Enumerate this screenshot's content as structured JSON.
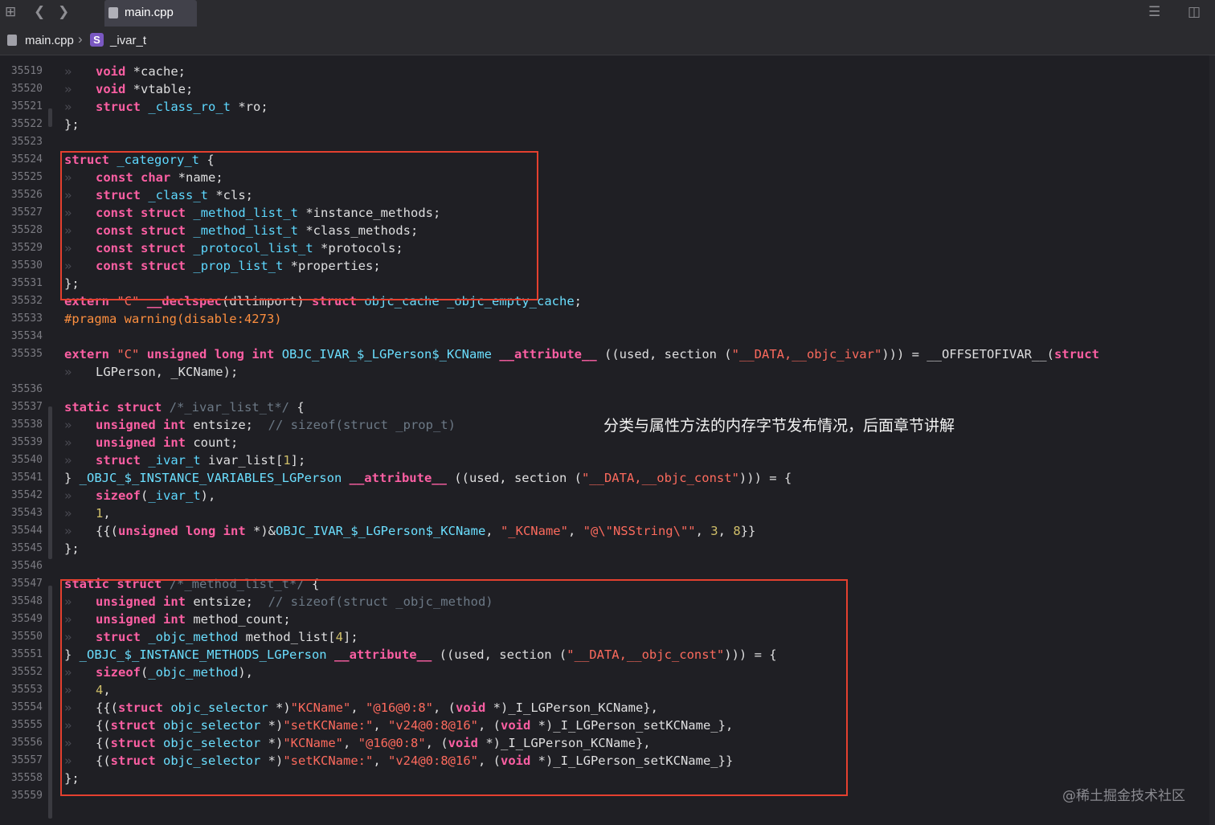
{
  "tab": {
    "label": "main.cpp"
  },
  "jumpbar": {
    "file": "main.cpp",
    "symbol_badge": "S",
    "symbol": "_ivar_t"
  },
  "annotation": "分类与属性方法的内存字节发布情况，后面章节讲解",
  "watermark": "@稀土掘金技术社区",
  "lines": [
    {
      "n": "35519",
      "lvl": 1,
      "code": "void *cache;"
    },
    {
      "n": "35520",
      "lvl": 1,
      "code": "void *vtable;"
    },
    {
      "n": "35521",
      "lvl": 1,
      "code": "struct _class_ro_t *ro;"
    },
    {
      "n": "35522",
      "lvl": 0,
      "code": "};"
    },
    {
      "n": "35523",
      "lvl": 0,
      "code": ""
    },
    {
      "n": "35524",
      "lvl": 0,
      "code": "struct _category_t {"
    },
    {
      "n": "35525",
      "lvl": 1,
      "code": "const char *name;"
    },
    {
      "n": "35526",
      "lvl": 1,
      "code": "struct _class_t *cls;"
    },
    {
      "n": "35527",
      "lvl": 1,
      "code": "const struct _method_list_t *instance_methods;"
    },
    {
      "n": "35528",
      "lvl": 1,
      "code": "const struct _method_list_t *class_methods;"
    },
    {
      "n": "35529",
      "lvl": 1,
      "code": "const struct _protocol_list_t *protocols;"
    },
    {
      "n": "35530",
      "lvl": 1,
      "code": "const struct _prop_list_t *properties;"
    },
    {
      "n": "35531",
      "lvl": 0,
      "code": "};"
    },
    {
      "n": "35532",
      "lvl": 0,
      "code": "extern \"C\" __declspec(dllimport) struct objc_cache _objc_empty_cache;"
    },
    {
      "n": "35533",
      "lvl": 0,
      "code": "#pragma warning(disable:4273)"
    },
    {
      "n": "35534",
      "lvl": 0,
      "code": ""
    },
    {
      "n": "35535",
      "lvl": 0,
      "code": "extern \"C\" unsigned long int OBJC_IVAR_$_LGPerson$_KCName __attribute__ ((used, section (\"__DATA,__objc_ivar\"))) = __OFFSETOFIVAR__(struct"
    },
    {
      "n": "",
      "lvl": 1,
      "code": "LGPerson, _KCName);"
    },
    {
      "n": "35536",
      "lvl": 0,
      "code": ""
    },
    {
      "n": "35537",
      "lvl": 0,
      "code": "static struct /*_ivar_list_t*/ {"
    },
    {
      "n": "35538",
      "lvl": 1,
      "code": "unsigned int entsize;  // sizeof(struct _prop_t)"
    },
    {
      "n": "35539",
      "lvl": 1,
      "code": "unsigned int count;"
    },
    {
      "n": "35540",
      "lvl": 1,
      "code": "struct _ivar_t ivar_list[1];"
    },
    {
      "n": "35541",
      "lvl": 0,
      "code": "} _OBJC_$_INSTANCE_VARIABLES_LGPerson __attribute__ ((used, section (\"__DATA,__objc_const\"))) = {"
    },
    {
      "n": "35542",
      "lvl": 1,
      "code": "sizeof(_ivar_t),"
    },
    {
      "n": "35543",
      "lvl": 1,
      "code": "1,"
    },
    {
      "n": "35544",
      "lvl": 1,
      "code": "{{(unsigned long int *)&OBJC_IVAR_$_LGPerson$_KCName, \"_KCName\", \"@\\\"NSString\\\"\", 3, 8}}"
    },
    {
      "n": "35545",
      "lvl": 0,
      "code": "};"
    },
    {
      "n": "35546",
      "lvl": 0,
      "code": ""
    },
    {
      "n": "35547",
      "lvl": 0,
      "code": "static struct /*_method_list_t*/ {"
    },
    {
      "n": "35548",
      "lvl": 1,
      "code": "unsigned int entsize;  // sizeof(struct _objc_method)"
    },
    {
      "n": "35549",
      "lvl": 1,
      "code": "unsigned int method_count;"
    },
    {
      "n": "35550",
      "lvl": 1,
      "code": "struct _objc_method method_list[4];"
    },
    {
      "n": "35551",
      "lvl": 0,
      "code": "} _OBJC_$_INSTANCE_METHODS_LGPerson __attribute__ ((used, section (\"__DATA,__objc_const\"))) = {"
    },
    {
      "n": "35552",
      "lvl": 1,
      "code": "sizeof(_objc_method),"
    },
    {
      "n": "35553",
      "lvl": 1,
      "code": "4,"
    },
    {
      "n": "35554",
      "lvl": 1,
      "code": "{{(struct objc_selector *)\"KCName\", \"@16@0:8\", (void *)_I_LGPerson_KCName},"
    },
    {
      "n": "35555",
      "lvl": 1,
      "code": "{(struct objc_selector *)\"setKCName:\", \"v24@0:8@16\", (void *)_I_LGPerson_setKCName_},"
    },
    {
      "n": "35556",
      "lvl": 1,
      "code": "{(struct objc_selector *)\"KCName\", \"@16@0:8\", (void *)_I_LGPerson_KCName},"
    },
    {
      "n": "35557",
      "lvl": 1,
      "code": "{(struct objc_selector *)\"setKCName:\", \"v24@0:8@16\", (void *)_I_LGPerson_setKCName_}}"
    },
    {
      "n": "35558",
      "lvl": 0,
      "code": "};"
    },
    {
      "n": "35559",
      "lvl": 0,
      "code": ""
    }
  ]
}
